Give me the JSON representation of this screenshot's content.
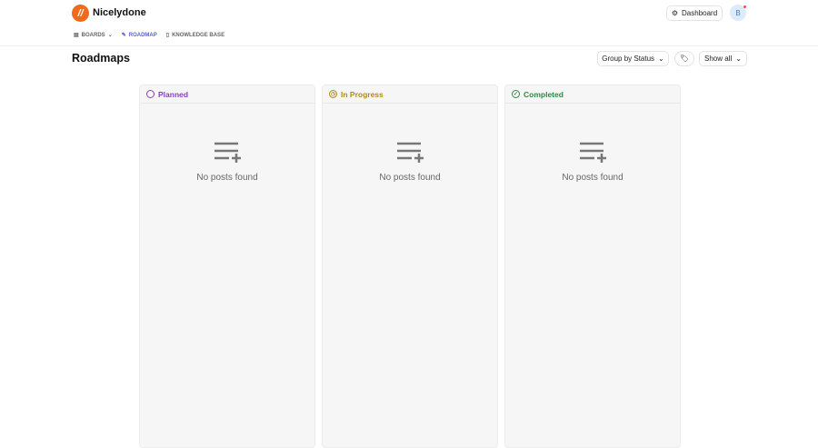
{
  "header": {
    "brand": "Nicelydone",
    "dashboard": "Dashboard",
    "avatar": "B"
  },
  "nav": [
    {
      "label": "BOARDS"
    },
    {
      "label": "ROADMAP"
    },
    {
      "label": "KNOWLEDGE BASE"
    }
  ],
  "page": {
    "title": "Roadmaps"
  },
  "toolbar": {
    "group": "Group by Status",
    "show": "Show all"
  },
  "columns": [
    {
      "label": "Planned",
      "color": "#8a3fbf",
      "empty": "No posts found"
    },
    {
      "label": "In Progress",
      "color": "#b08a1a",
      "empty": "No posts found"
    },
    {
      "label": "Completed",
      "color": "#2e8a45",
      "empty": "No posts found"
    }
  ]
}
